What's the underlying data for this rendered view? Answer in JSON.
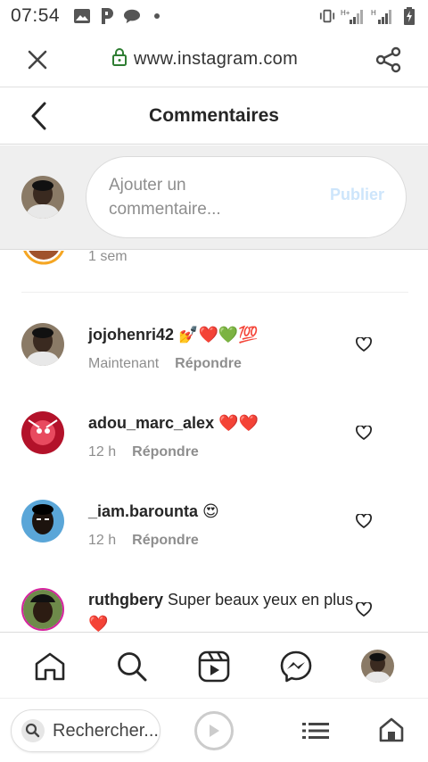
{
  "status_bar": {
    "time": "07:54",
    "network_label_1": "H+",
    "network_label_2": "H"
  },
  "browser": {
    "domain": "www.instagram.com"
  },
  "page": {
    "title": "Commentaires"
  },
  "composer": {
    "placeholder": "Ajouter un commentaire...",
    "publish_label": "Publier"
  },
  "previous_comment": {
    "time": "1 sem"
  },
  "comments": [
    {
      "username": "jojohenri42",
      "text": "💅❤️💚💯",
      "time": "Maintenant",
      "reply_label": "Répondre"
    },
    {
      "username": "adou_marc_alex",
      "text": "❤️❤️",
      "time": "12 h",
      "reply_label": "Répondre"
    },
    {
      "username": "_iam.barounta",
      "text": "😍",
      "time": "12 h",
      "reply_label": "Répondre"
    },
    {
      "username": "ruthgbery",
      "text": "Super beaux yeux en plus ❤️",
      "time": "",
      "reply_label": ""
    }
  ],
  "bottom_nav": {
    "items": [
      "home-icon",
      "search-icon",
      "reels-icon",
      "messenger-icon",
      "profile-avatar"
    ]
  },
  "browser_bottom": {
    "search_label": "Rechercher..."
  },
  "colors": {
    "text_primary": "#262626",
    "text_secondary": "#8e8e8e",
    "composer_bg": "#efefef",
    "publish_disabled": "#cde5fb",
    "lock_green": "#2e7d32"
  }
}
